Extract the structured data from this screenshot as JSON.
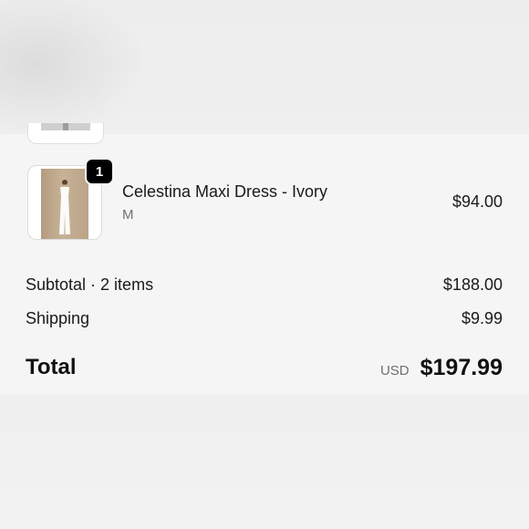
{
  "order_summary": {
    "line_items": [
      {
        "name": "Celestina Maxi Dress - Ivory",
        "variant": "M",
        "quantity": "1",
        "price": "$94.00",
        "thumbnail_icon": "dress-photo-icon"
      }
    ],
    "subtotal": {
      "label": "Subtotal · 2 items",
      "value": "$188.00"
    },
    "shipping": {
      "label": "Shipping",
      "value": "$9.99"
    },
    "total": {
      "label": "Total",
      "currency": "USD",
      "value": "$197.99"
    }
  },
  "colors": {
    "badge_background": "#000000",
    "text_primary": "#1a1a1a",
    "text_secondary": "#707070",
    "summary_background": "#f5f5f5"
  }
}
